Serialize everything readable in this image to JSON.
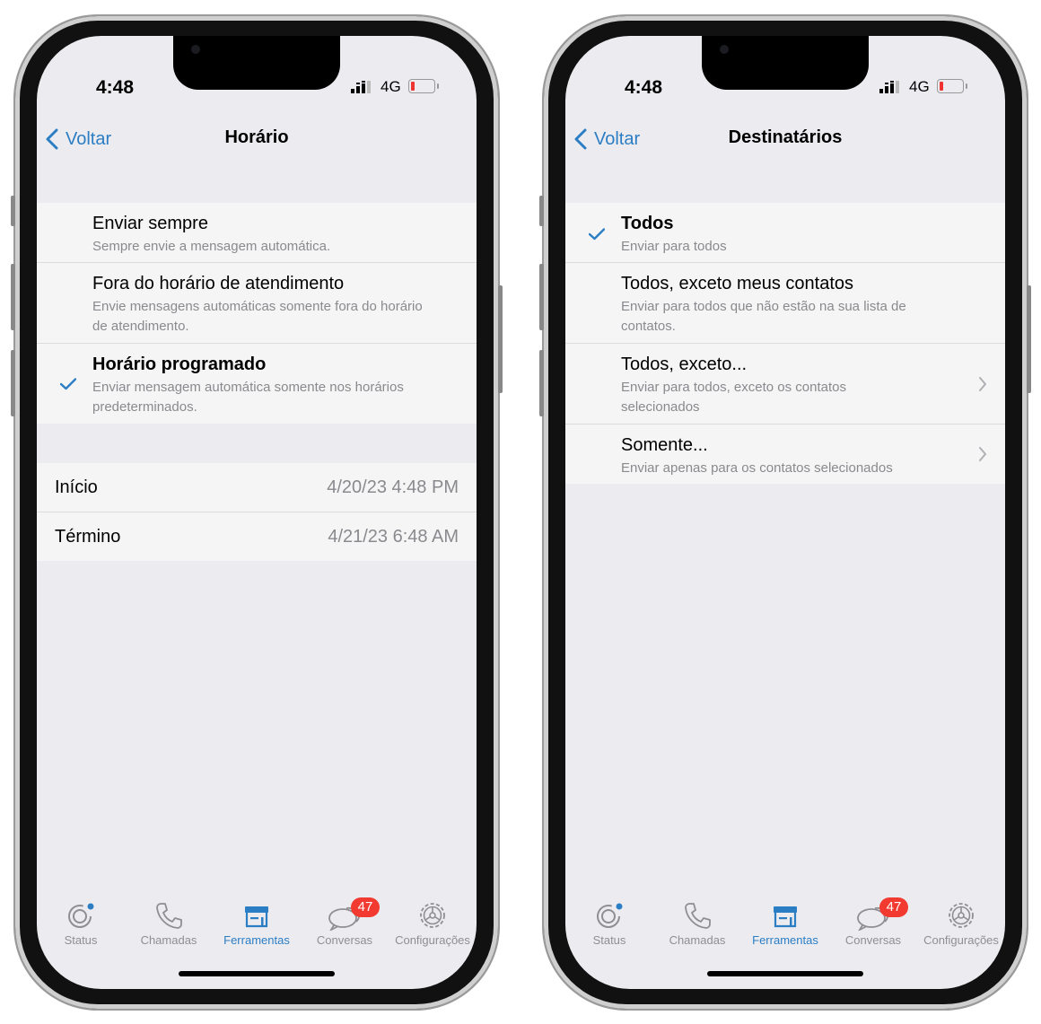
{
  "status_bar": {
    "time": "4:48",
    "network": "4G"
  },
  "left": {
    "nav": {
      "back_label": "Voltar",
      "title": "Horário"
    },
    "options": [
      {
        "title": "Enviar sempre",
        "subtitle": "Sempre envie a mensagem automática."
      },
      {
        "title": "Fora do horário de atendimento",
        "subtitle": "Envie mensagens automáticas somente fora do horário de atendimento."
      },
      {
        "title": "Horário programado",
        "subtitle": "Enviar mensagem automática somente nos horários predeterminados."
      }
    ],
    "schedule": [
      {
        "label": "Início",
        "value": "4/20/23 4:48 PM"
      },
      {
        "label": "Término",
        "value": "4/21/23 6:48 AM"
      }
    ]
  },
  "right": {
    "nav": {
      "back_label": "Voltar",
      "title": "Destinatários"
    },
    "options": [
      {
        "title": "Todos",
        "subtitle": "Enviar para todos"
      },
      {
        "title": "Todos, exceto meus contatos",
        "subtitle": "Enviar para todos que não estão na sua lista de contatos."
      },
      {
        "title": "Todos, exceto...",
        "subtitle": "Enviar para todos, exceto os contatos selecionados"
      },
      {
        "title": "Somente...",
        "subtitle": "Enviar apenas para os contatos selecionados"
      }
    ]
  },
  "tabbar": {
    "tabs": [
      {
        "label": "Status",
        "icon": "status-icon"
      },
      {
        "label": "Chamadas",
        "icon": "phone-icon"
      },
      {
        "label": "Ferramentas",
        "icon": "store-icon"
      },
      {
        "label": "Conversas",
        "icon": "chat-bubbles-icon"
      },
      {
        "label": "Configurações",
        "icon": "gear-icon"
      }
    ],
    "conversas_badge": "47",
    "active_color": "#2b7dc4",
    "badge_color": "#f23a30"
  }
}
